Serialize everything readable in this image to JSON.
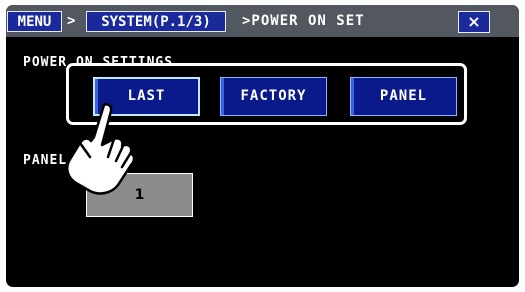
{
  "header": {
    "menu_label": "MENU",
    "separator": ">",
    "system_label": "SYSTEM(P.1/3)",
    "current_page": ">POWER ON SET",
    "close_label": "×"
  },
  "settings": {
    "power_on_label": "POWER ON SETTINGS",
    "options": [
      "LAST",
      "FACTORY",
      "PANEL"
    ],
    "selected_option": "LAST",
    "panel_no_label": "PANEL No.",
    "panel_no_value": "1"
  },
  "colors": {
    "header_bg": "#535760",
    "button_blue": "#0a1a8a",
    "screen_bg": "#000000",
    "value_box": "#8c8c8c"
  },
  "icons": {
    "pointer": "pointing-hand-icon",
    "close": "close-icon"
  }
}
